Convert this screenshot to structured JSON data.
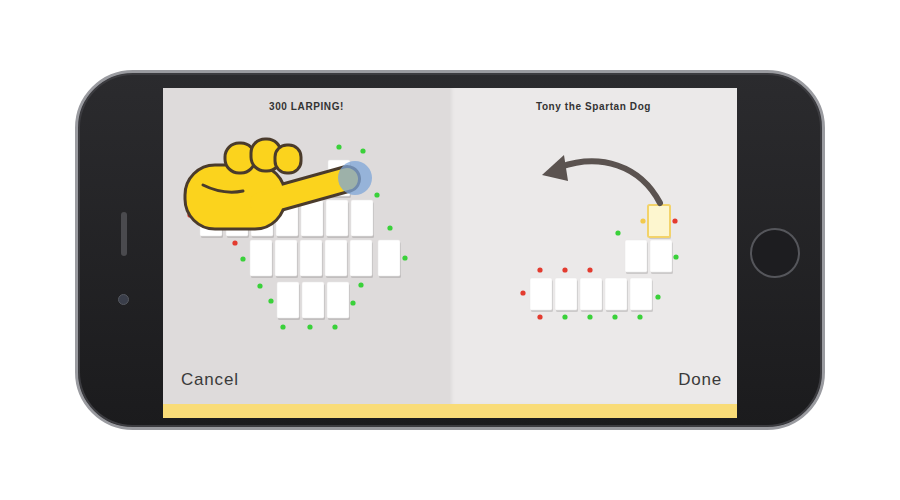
{
  "panels": [
    {
      "title": "300 LARPING!",
      "kind": "tap",
      "button": "Cancel",
      "cards": [
        {
          "selected": true
        },
        {
          "selected": false
        },
        {
          "selected": false
        },
        {
          "selected": false
        },
        {
          "selected": false
        },
        {
          "selected": false
        },
        {
          "selected": false
        },
        {
          "selected": false
        },
        {
          "selected": false
        },
        {
          "selected": false
        },
        {
          "selected": false
        },
        {
          "selected": false
        },
        {
          "selected": false
        },
        {
          "selected": false
        },
        {
          "selected": false
        },
        {
          "selected": false
        },
        {
          "selected": false
        }
      ],
      "dots": [
        {
          "color": "#3ad13a"
        },
        {
          "color": "#e33b2f"
        },
        {
          "color": "#e33b2f"
        },
        {
          "color": "#3ad13a"
        },
        {
          "color": "#3ad13a"
        },
        {
          "color": "#3ad13a"
        },
        {
          "color": "#3ad13a"
        },
        {
          "color": "#3ad13a"
        },
        {
          "color": "#3ad13a"
        },
        {
          "color": "#3ad13a"
        },
        {
          "color": "#3ad13a"
        },
        {
          "color": "#3ad13a"
        },
        {
          "color": "#3ad13a"
        },
        {
          "color": "#3ad13a"
        },
        {
          "color": "#3ad13a"
        }
      ]
    },
    {
      "title": "Tony the Spartan Dog",
      "kind": "move",
      "button": "Done",
      "cards": [
        {
          "selected": false
        },
        {
          "selected": false
        },
        {
          "selected": false
        },
        {
          "selected": false
        },
        {
          "selected": false
        },
        {
          "selected": false
        },
        {
          "selected": false
        },
        {
          "selected": true
        }
      ],
      "dots": [
        {
          "color": "#e33b2f"
        },
        {
          "color": "#e33b2f"
        },
        {
          "color": "#e33b2f"
        },
        {
          "color": "#e33b2f"
        },
        {
          "color": "#e33b2f"
        },
        {
          "color": "#3ad13a"
        },
        {
          "color": "#3ad13a"
        },
        {
          "color": "#3ad13a"
        },
        {
          "color": "#3ad13a"
        },
        {
          "color": "#3ad13a"
        },
        {
          "color": "#3ad13a"
        },
        {
          "color": "#3ad13a"
        },
        {
          "color": "#e33b2f"
        },
        {
          "color": "#f2c94c"
        }
      ]
    }
  ]
}
